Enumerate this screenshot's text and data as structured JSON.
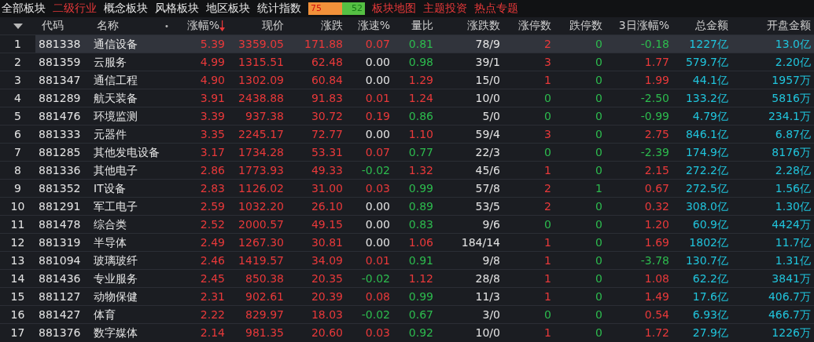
{
  "tabs": [
    {
      "label": "全部板块",
      "selected": false,
      "kind": "tab"
    },
    {
      "label": "二级行业",
      "selected": true,
      "kind": "tab"
    },
    {
      "label": "概念板块",
      "selected": false,
      "kind": "tab"
    },
    {
      "label": "风格板块",
      "selected": false,
      "kind": "tab"
    },
    {
      "label": "地区板块",
      "selected": false,
      "kind": "tab"
    },
    {
      "label": "统计指数",
      "selected": false,
      "kind": "tab"
    },
    {
      "kind": "ratio",
      "up": "75",
      "down": "52"
    },
    {
      "label": "板块地图",
      "kind": "link"
    },
    {
      "label": "主题投资",
      "kind": "link"
    },
    {
      "label": "热点专题",
      "kind": "link"
    }
  ],
  "table": {
    "columns": [
      {
        "kind": "menu"
      },
      {
        "label": "代码",
        "kind": "code"
      },
      {
        "label": "名称",
        "kind": "name",
        "marker": "•"
      },
      {
        "label": "涨幅%",
        "kind": "sign",
        "sorted": true
      },
      {
        "label": "现价",
        "kind": "follow"
      },
      {
        "label": "涨跌",
        "kind": "sign"
      },
      {
        "label": "涨速%",
        "kind": "sign"
      },
      {
        "label": "量比",
        "kind": "ratio"
      },
      {
        "label": "涨跌数",
        "kind": "plain"
      },
      {
        "label": "涨停数",
        "kind": "count"
      },
      {
        "label": "跌停数",
        "kind": "down"
      },
      {
        "label": "3日涨幅%",
        "kind": "sign"
      },
      {
        "label": "总金额",
        "kind": "amount"
      },
      {
        "label": "开盘金额",
        "kind": "amount"
      }
    ],
    "rows": [
      {
        "selected": true,
        "cells": [
          "1",
          "881338",
          "通信设备",
          "5.39",
          "3359.05",
          "171.88",
          "0.07",
          "0.81",
          "78/9",
          "2",
          "0",
          "-0.18",
          "1227亿",
          "13.0亿"
        ]
      },
      {
        "selected": false,
        "cells": [
          "2",
          "881359",
          "云服务",
          "4.99",
          "1315.51",
          "62.48",
          "0.00",
          "0.98",
          "39/1",
          "3",
          "0",
          "1.77",
          "579.7亿",
          "2.20亿"
        ]
      },
      {
        "selected": false,
        "cells": [
          "3",
          "881347",
          "通信工程",
          "4.90",
          "1302.09",
          "60.84",
          "0.00",
          "1.29",
          "15/0",
          "1",
          "0",
          "1.99",
          "44.1亿",
          "1957万"
        ]
      },
      {
        "selected": false,
        "cells": [
          "4",
          "881289",
          "航天装备",
          "3.91",
          "2438.88",
          "91.83",
          "0.01",
          "1.24",
          "10/0",
          "0",
          "0",
          "-2.50",
          "133.2亿",
          "5816万"
        ]
      },
      {
        "selected": false,
        "cells": [
          "5",
          "881476",
          "环境监测",
          "3.39",
          "937.38",
          "30.72",
          "0.19",
          "0.86",
          "5/0",
          "0",
          "0",
          "-0.99",
          "4.79亿",
          "234.1万"
        ]
      },
      {
        "selected": false,
        "cells": [
          "6",
          "881333",
          "元器件",
          "3.35",
          "2245.17",
          "72.77",
          "0.00",
          "1.10",
          "59/4",
          "3",
          "0",
          "2.75",
          "846.1亿",
          "6.87亿"
        ]
      },
      {
        "selected": false,
        "cells": [
          "7",
          "881285",
          "其他发电设备",
          "3.17",
          "1734.28",
          "53.31",
          "0.07",
          "0.77",
          "22/3",
          "0",
          "0",
          "-2.39",
          "174.9亿",
          "8176万"
        ]
      },
      {
        "selected": false,
        "cells": [
          "8",
          "881336",
          "其他电子",
          "2.86",
          "1773.93",
          "49.33",
          "-0.02",
          "1.32",
          "45/6",
          "1",
          "0",
          "2.15",
          "272.2亿",
          "2.28亿"
        ]
      },
      {
        "selected": false,
        "cells": [
          "9",
          "881352",
          "IT设备",
          "2.83",
          "1126.02",
          "31.00",
          "0.03",
          "0.99",
          "57/8",
          "2",
          "1",
          "0.67",
          "272.5亿",
          "1.56亿"
        ]
      },
      {
        "selected": false,
        "cells": [
          "10",
          "881291",
          "军工电子",
          "2.59",
          "1032.20",
          "26.10",
          "0.00",
          "0.89",
          "53/5",
          "2",
          "0",
          "0.32",
          "308.0亿",
          "1.30亿"
        ]
      },
      {
        "selected": false,
        "cells": [
          "11",
          "881478",
          "综合类",
          "2.52",
          "2000.57",
          "49.15",
          "0.00",
          "0.83",
          "9/6",
          "0",
          "0",
          "1.20",
          "60.9亿",
          "4424万"
        ]
      },
      {
        "selected": false,
        "cells": [
          "12",
          "881319",
          "半导体",
          "2.49",
          "1267.30",
          "30.81",
          "0.00",
          "1.06",
          "184/14",
          "1",
          "0",
          "1.69",
          "1802亿",
          "11.7亿"
        ]
      },
      {
        "selected": false,
        "cells": [
          "13",
          "881094",
          "玻璃玻纤",
          "2.46",
          "1419.57",
          "34.09",
          "0.01",
          "0.91",
          "9/8",
          "1",
          "0",
          "-3.78",
          "130.7亿",
          "1.31亿"
        ]
      },
      {
        "selected": false,
        "cells": [
          "14",
          "881436",
          "专业服务",
          "2.45",
          "850.38",
          "20.35",
          "-0.02",
          "1.12",
          "28/8",
          "1",
          "0",
          "1.08",
          "62.2亿",
          "3841万"
        ]
      },
      {
        "selected": false,
        "cells": [
          "15",
          "881127",
          "动物保健",
          "2.31",
          "902.61",
          "20.39",
          "0.08",
          "0.99",
          "11/3",
          "1",
          "0",
          "1.49",
          "17.6亿",
          "406.7万"
        ]
      },
      {
        "selected": false,
        "cells": [
          "16",
          "881427",
          "体育",
          "2.22",
          "829.97",
          "18.03",
          "-0.02",
          "0.67",
          "3/0",
          "0",
          "0",
          "0.54",
          "6.93亿",
          "466.7万"
        ]
      },
      {
        "selected": false,
        "cells": [
          "17",
          "881376",
          "数字媒体",
          "2.14",
          "981.35",
          "20.60",
          "0.03",
          "0.92",
          "10/0",
          "1",
          "0",
          "1.72",
          "27.9亿",
          "1226万"
        ]
      }
    ]
  }
}
